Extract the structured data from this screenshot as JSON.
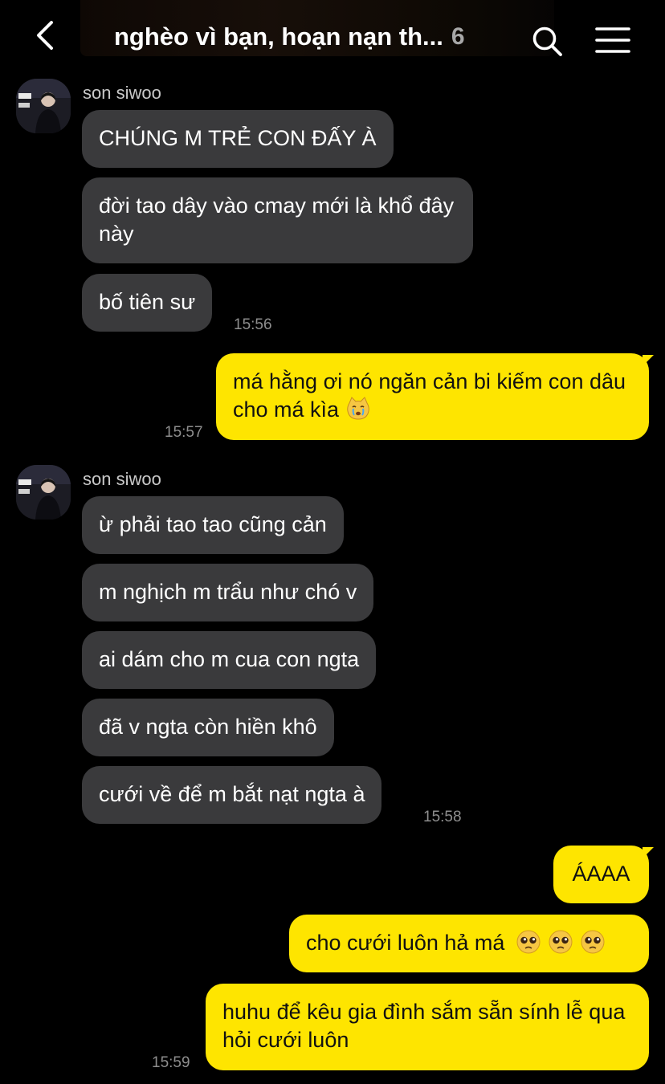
{
  "header": {
    "title": "nghèo vì bạn, hoạn nạn th...",
    "member_count": "6",
    "back_icon": "chevron-left-icon",
    "search_icon": "search-icon",
    "menu_icon": "hamburger-menu-icon"
  },
  "colors": {
    "background": "#000000",
    "incoming_bubble": "#3a3a3c",
    "outgoing_bubble": "#fee500",
    "timestamp": "#8e8e8e"
  },
  "messages": {
    "group1": {
      "sender": "son siwoo",
      "m1": "CHÚNG M TRẺ CON ĐẤY À",
      "m2": "đời tao dây vào cmay mới là khổ đây này",
      "m3": "bố tiên sư",
      "time": "15:56"
    },
    "group2": {
      "m1": "má hằng ơi nó ngăn cản bi kiếm con dâu cho má kìa",
      "m1_emoji": "crying-cat-emoji",
      "time": "15:57"
    },
    "group3": {
      "sender": "son siwoo",
      "m1": "ừ phải tao tao cũng cản",
      "m2": "m nghịch m trẩu như chó v",
      "m3": "ai dám cho m cua con ngta",
      "m4": "đã v ngta còn hiền khô",
      "m5": "cưới về để m bắt nạt ngta à",
      "time": "15:58"
    },
    "group4": {
      "m1": "ÁAAA",
      "m2": "cho cưới luôn hả má",
      "m2_emoji": "pleading-face-emoji",
      "m3": "huhu để kêu gia đình sắm sẵn sính lễ qua hỏi cưới luôn",
      "time": "15:59"
    }
  }
}
